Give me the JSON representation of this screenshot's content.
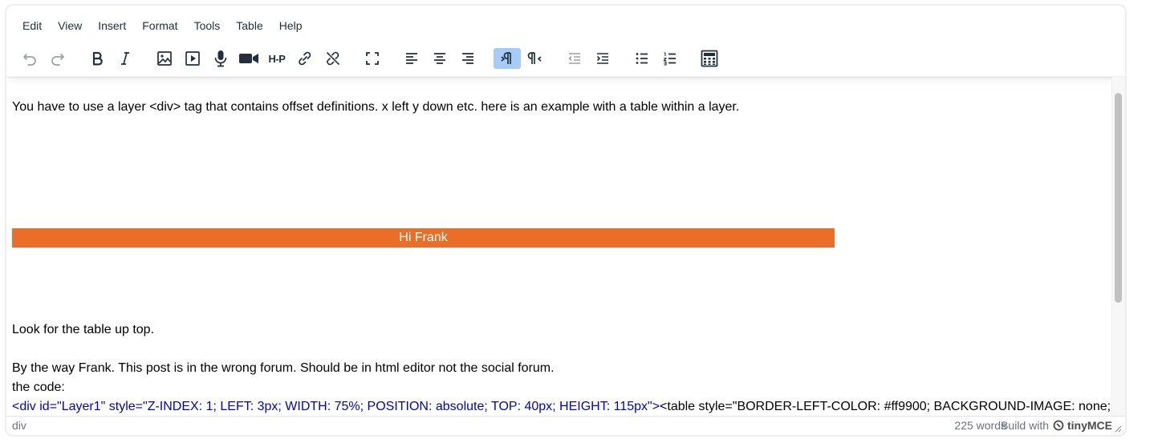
{
  "menubar": {
    "items": [
      "Edit",
      "View",
      "Insert",
      "Format",
      "Tools",
      "Table",
      "Help"
    ]
  },
  "toolbar": {
    "groups": [
      [
        "undo-icon",
        "redo-icon"
      ],
      [
        "bold-icon",
        "italic-icon"
      ],
      [
        "image-icon",
        "media-icon",
        "microphone-icon",
        "video-camera-icon",
        "h5p-icon",
        "link-icon",
        "unlink-icon"
      ],
      [
        "fullscreen-icon"
      ],
      [
        "align-left-icon",
        "align-center-icon",
        "align-right-icon"
      ],
      [
        "ltr-icon",
        "rtl-icon"
      ],
      [
        "outdent-icon",
        "indent-icon"
      ],
      [
        "bullet-list-icon",
        "numbered-list-icon"
      ],
      [
        "calculator-icon"
      ]
    ],
    "h5p_label": "H-P",
    "active": "ltr-icon",
    "disabled": [
      "undo-icon",
      "redo-icon",
      "outdent-icon"
    ]
  },
  "content": {
    "intro": "You have to use a layer <div> tag that contains offset definitions. x left y down etc. here is an example with a table within a layer.",
    "banner": "Hi Frank",
    "look": "Look for the table up top.",
    "byway": "By the way Frank.  This post is in the wrong forum.  Should be in html editor not the social forum.",
    "code_label": "the code:",
    "code_blue": "<div id=\"Layer1\" style=\"Z-INDEX: 1; LEFT: 3px; WIDTH: 75%; POSITION: absolute; TOP: 40px; HEIGHT: 115px\">",
    "code_black": "<table style=\"BORDER-LEFT-COLOR: #ff9900; BACKGROUND-IMAGE: none;"
  },
  "statusbar": {
    "path": "div",
    "word_count": "225 words",
    "build_with": "Build with",
    "brand": "tinyMCE"
  },
  "colors": {
    "banner": "#ec6d27",
    "code_blue": "#0000cc",
    "active_button": "#a6ccf7"
  }
}
